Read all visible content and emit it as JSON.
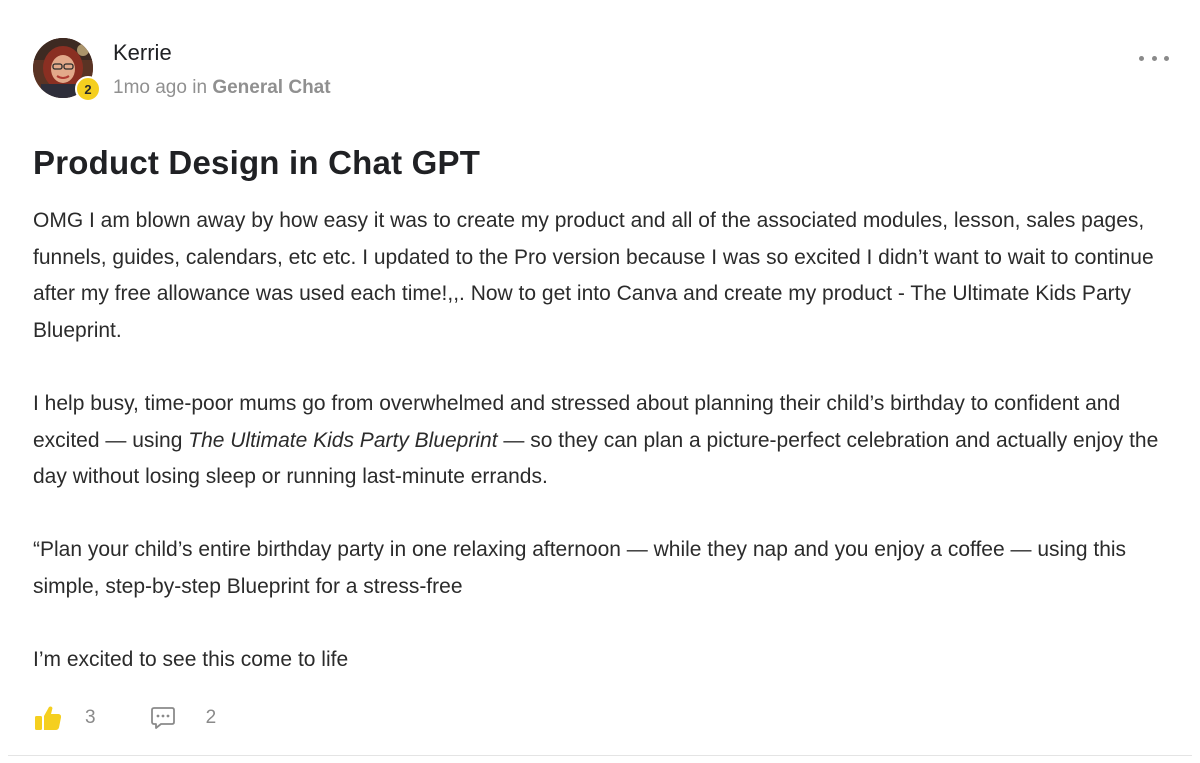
{
  "post": {
    "author": {
      "name": "Kerrie",
      "level": "2",
      "avatar": "avatar-photo"
    },
    "time_ago": "1mo ago",
    "in_label": "in",
    "category": "General Chat",
    "title": "Product Design in Chat GPT",
    "paragraphs": {
      "p1": "OMG I am blown away by how easy it was to create my product and all of the associated modules, lesson, sales pages, funnels, guides, calendars, etc etc. I updated to the Pro version because I was so excited I didn’t want to wait to continue after my free allowance was used each time!,,. Now to get into Canva and create my product - The Ultimate Kids Party Blueprint.",
      "p2_before": "I help busy, time-poor mums go from overwhelmed and stressed about planning their child’s birthday to confident and excited — using ",
      "p2_italic": "The Ultimate Kids Party Blueprint",
      "p2_after": " — so they can plan a picture-perfect celebration and actually enjoy the day without losing sleep or running last-minute errands.",
      "p3": "“Plan your child’s entire birthday party in one relaxing afternoon — while they nap and you enjoy a coffee — using this simple, step-by-step Blueprint for a stress-free",
      "p4": "I’m excited to see this come to life"
    },
    "likes": "3",
    "comments": "2",
    "icons": {
      "like": "thumbs-up-icon",
      "comment": "comment-icon",
      "more": "more-options-icon"
    },
    "colors": {
      "like_yellow": "#f5cf1f",
      "badge_yellow": "#f5cf1f",
      "muted_text": "#909090"
    }
  }
}
